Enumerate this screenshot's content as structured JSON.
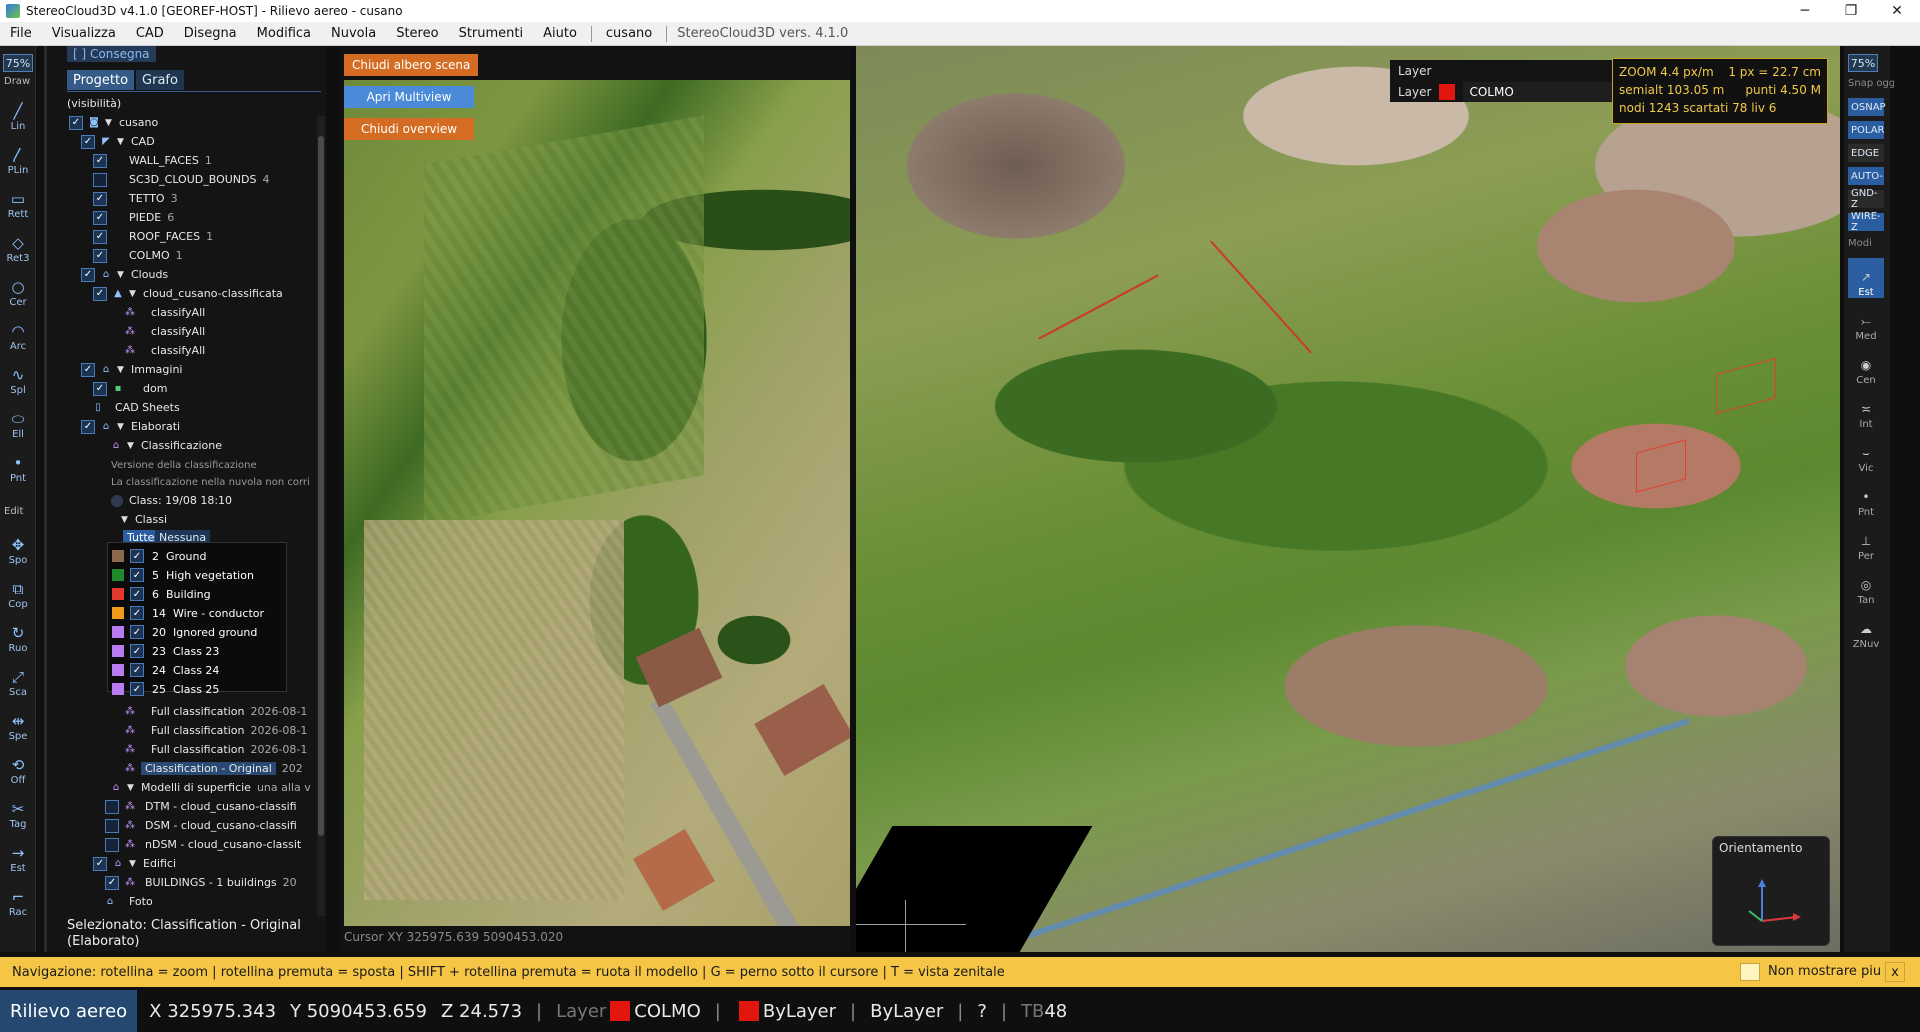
{
  "window": {
    "title": "StereoCloud3D v4.1.0  [GEOREF-HOST]  -  Rilievo aereo  -  cusano",
    "minimize": "─",
    "maximize": "❐",
    "close": "✕"
  },
  "menu": {
    "items": [
      "File",
      "Visualizza",
      "CAD",
      "Disegna",
      "Modifica",
      "Nuvola",
      "Stereo",
      "Strumenti",
      "Aiuto"
    ],
    "project": "cusano",
    "version": "StereoCloud3D vers. 4.1.0"
  },
  "left_toolbar": {
    "zoom": "75%",
    "draw_label": "Draw",
    "edit_label": "Edit",
    "draw_tools": [
      {
        "label": "Lin",
        "icon": "line-icon"
      },
      {
        "label": "PLin",
        "icon": "polyline-icon"
      },
      {
        "label": "Rett",
        "icon": "rectangle-icon"
      },
      {
        "label": "Ret3",
        "icon": "rect3-icon"
      },
      {
        "label": "Cer",
        "icon": "circle-icon"
      },
      {
        "label": "Arc",
        "icon": "arc-icon"
      },
      {
        "label": "Spl",
        "icon": "spline-icon"
      },
      {
        "label": "Ell",
        "icon": "ellipse-icon"
      },
      {
        "label": "Pnt",
        "icon": "point-icon"
      }
    ],
    "edit_tools": [
      {
        "label": "Spo",
        "icon": "move-icon"
      },
      {
        "label": "Cop",
        "icon": "copy-icon"
      },
      {
        "label": "Ruo",
        "icon": "rotate-icon"
      },
      {
        "label": "Sca",
        "icon": "scale-icon"
      },
      {
        "label": "Spe",
        "icon": "mirror-icon"
      },
      {
        "label": "Off",
        "icon": "offset-icon"
      },
      {
        "label": "Tag",
        "icon": "trim-icon"
      },
      {
        "label": "Est",
        "icon": "extend-icon"
      },
      {
        "label": "Rac",
        "icon": "fillet-icon"
      }
    ]
  },
  "tree_panel": {
    "consegna": "[ ] Consegna",
    "tabs": [
      "Progetto",
      "Grafo"
    ],
    "visibility": "(visibilità)",
    "root": "cusano",
    "cad": "CAD",
    "cad_layers": [
      {
        "name": "WALL_FACES",
        "count": "1"
      },
      {
        "name": "SC3D_CLOUD_BOUNDS",
        "count": "4"
      },
      {
        "name": "TETTO",
        "count": "3"
      },
      {
        "name": "PIEDE",
        "count": "6"
      },
      {
        "name": "ROOF_FACES",
        "count": "1"
      },
      {
        "name": "COLMO",
        "count": "1"
      }
    ],
    "clouds": "Clouds",
    "cloud_name": "cloud_cusano-classificata",
    "classify": [
      "classifyAll",
      "classifyAll",
      "classifyAll"
    ],
    "immagini": "Immagini",
    "dom": "dom",
    "cad_sheets": "CAD Sheets",
    "elaborati": "Elaborati",
    "classificazione": "Classificazione",
    "versione": "Versione della classificazione",
    "nota": "La classificazione nella nuvola non corri",
    "class_date": "Class: 19/08 18:10",
    "classi": "Classi",
    "tutte": "Tutte",
    "nessuna": "Nessuna",
    "classes": [
      {
        "code": "2",
        "name": "Ground",
        "color": "#8a6a4a"
      },
      {
        "code": "5",
        "name": "High vegetation",
        "color": "#1f8a2c"
      },
      {
        "code": "6",
        "name": "Building",
        "color": "#e23b2e"
      },
      {
        "code": "14",
        "name": "Wire - conductor",
        "color": "#f29a1b"
      },
      {
        "code": "20",
        "name": "Ignored ground",
        "color": "#b87cf0"
      },
      {
        "code": "23",
        "name": "Class 23",
        "color": "#b87cf0"
      },
      {
        "code": "24",
        "name": "Class 24",
        "color": "#b87cf0"
      },
      {
        "code": "25",
        "name": "Class 25",
        "color": "#b87cf0"
      }
    ],
    "classifications": [
      {
        "name": "Full classification",
        "date": "2026-08-1"
      },
      {
        "name": "Full classification",
        "date": "2026-08-1"
      },
      {
        "name": "Full classification",
        "date": "2026-08-1"
      },
      {
        "name": "Classification - Original",
        "date": "202"
      }
    ],
    "modelli": "Modelli di superficie",
    "modelli_note": "una alla v",
    "surfaces": [
      "DTM - cloud_cusano-classifi",
      "DSM - cloud_cusano-classifi",
      "nDSM - cloud_cusano-classit"
    ],
    "edifici": "Edifici",
    "buildings": "BUILDINGS - 1 buildings",
    "buildings_date": "20",
    "foto": "Foto",
    "selected": "Selezionato: Classification - Original (Elaborato)"
  },
  "ortho_view": {
    "btn_close_tree": "Chiudi albero scena",
    "btn_multiview": "Apri Multiview",
    "btn_close_overview": "Chiudi overview",
    "cursor": "Cursor XY   325975.639   5090453.020"
  },
  "view3d": {
    "layer_title": "Layer",
    "layer_label": "Layer",
    "layer_value": "COLMO",
    "layer_color": "#e3160f",
    "zoom": "ZOOM  4.4 px/m",
    "px": "1 px = 22.7 cm",
    "semialt": "semialt 103.05 m",
    "punti": "punti 4.50 M",
    "nodi": "nodi 1243   scartati 78   liv 6",
    "orient_title": "Orientamento"
  },
  "right_toolbar": {
    "zoom": "75%",
    "snap_label": "Snap oggetto",
    "snaps": [
      {
        "label": "OSNAP",
        "on": true
      },
      {
        "label": "POLAR",
        "on": true
      },
      {
        "label": "EDGE",
        "on": false
      },
      {
        "label": "AUTO-",
        "on": true
      },
      {
        "label": "GND-Z",
        "on": false
      },
      {
        "label": "WIRE-Z",
        "on": true
      }
    ],
    "modi_label": "Modi",
    "modes": [
      {
        "label": "Est",
        "icon": "endpoint-icon",
        "on": true
      },
      {
        "label": "Med",
        "icon": "midpoint-icon",
        "on": false
      },
      {
        "label": "Cen",
        "icon": "center-icon",
        "on": false
      },
      {
        "label": "Int",
        "icon": "intersection-icon",
        "on": false
      },
      {
        "label": "Vic",
        "icon": "nearest-icon",
        "on": false
      },
      {
        "label": "Pnt",
        "icon": "node-icon",
        "on": false
      },
      {
        "label": "Per",
        "icon": "perpendicular-icon",
        "on": false
      },
      {
        "label": "Tan",
        "icon": "tangent-icon",
        "on": false
      },
      {
        "label": "ZNuv",
        "icon": "cloud-z-icon",
        "on": false
      }
    ]
  },
  "nav_hint": {
    "text": "Navigazione:  rotellina = zoom   |   rotellina premuta = sposta   |   SHIFT + rotellina premuta = ruota il modello   |   G = perno sotto il cursore   |   T = vista zenitale",
    "dont_show": "Non mostrare piu",
    "close": "x"
  },
  "status": {
    "mode": "Rilievo aereo",
    "x": "X 325975.343",
    "y": "Y 5090453.659",
    "z": "Z 24.573",
    "layer_label": "Layer",
    "layer_value": "COLMO",
    "color": "ByLayer",
    "linetype": "ByLayer",
    "help": "?",
    "tb_label": "TB",
    "tb_value": "48"
  }
}
